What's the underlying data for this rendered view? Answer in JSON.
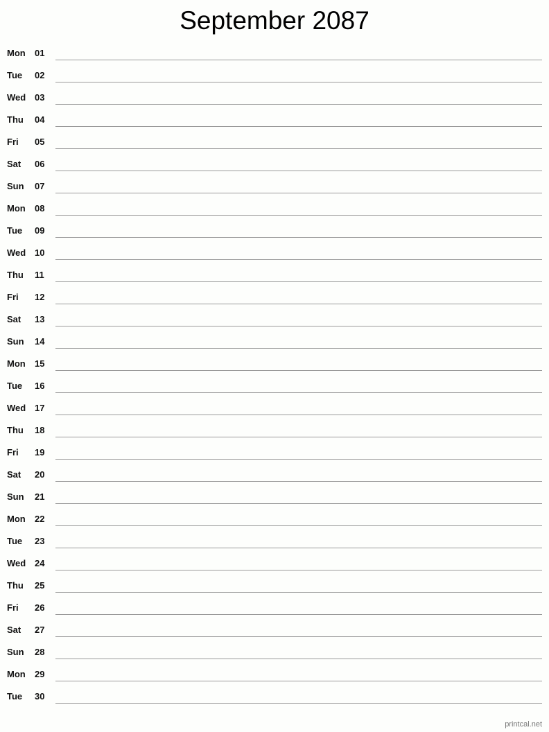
{
  "title": "September 2087",
  "days": [
    {
      "dow": "Mon",
      "num": "01"
    },
    {
      "dow": "Tue",
      "num": "02"
    },
    {
      "dow": "Wed",
      "num": "03"
    },
    {
      "dow": "Thu",
      "num": "04"
    },
    {
      "dow": "Fri",
      "num": "05"
    },
    {
      "dow": "Sat",
      "num": "06"
    },
    {
      "dow": "Sun",
      "num": "07"
    },
    {
      "dow": "Mon",
      "num": "08"
    },
    {
      "dow": "Tue",
      "num": "09"
    },
    {
      "dow": "Wed",
      "num": "10"
    },
    {
      "dow": "Thu",
      "num": "11"
    },
    {
      "dow": "Fri",
      "num": "12"
    },
    {
      "dow": "Sat",
      "num": "13"
    },
    {
      "dow": "Sun",
      "num": "14"
    },
    {
      "dow": "Mon",
      "num": "15"
    },
    {
      "dow": "Tue",
      "num": "16"
    },
    {
      "dow": "Wed",
      "num": "17"
    },
    {
      "dow": "Thu",
      "num": "18"
    },
    {
      "dow": "Fri",
      "num": "19"
    },
    {
      "dow": "Sat",
      "num": "20"
    },
    {
      "dow": "Sun",
      "num": "21"
    },
    {
      "dow": "Mon",
      "num": "22"
    },
    {
      "dow": "Tue",
      "num": "23"
    },
    {
      "dow": "Wed",
      "num": "24"
    },
    {
      "dow": "Thu",
      "num": "25"
    },
    {
      "dow": "Fri",
      "num": "26"
    },
    {
      "dow": "Sat",
      "num": "27"
    },
    {
      "dow": "Sun",
      "num": "28"
    },
    {
      "dow": "Mon",
      "num": "29"
    },
    {
      "dow": "Tue",
      "num": "30"
    }
  ],
  "footer": "printcal.net"
}
